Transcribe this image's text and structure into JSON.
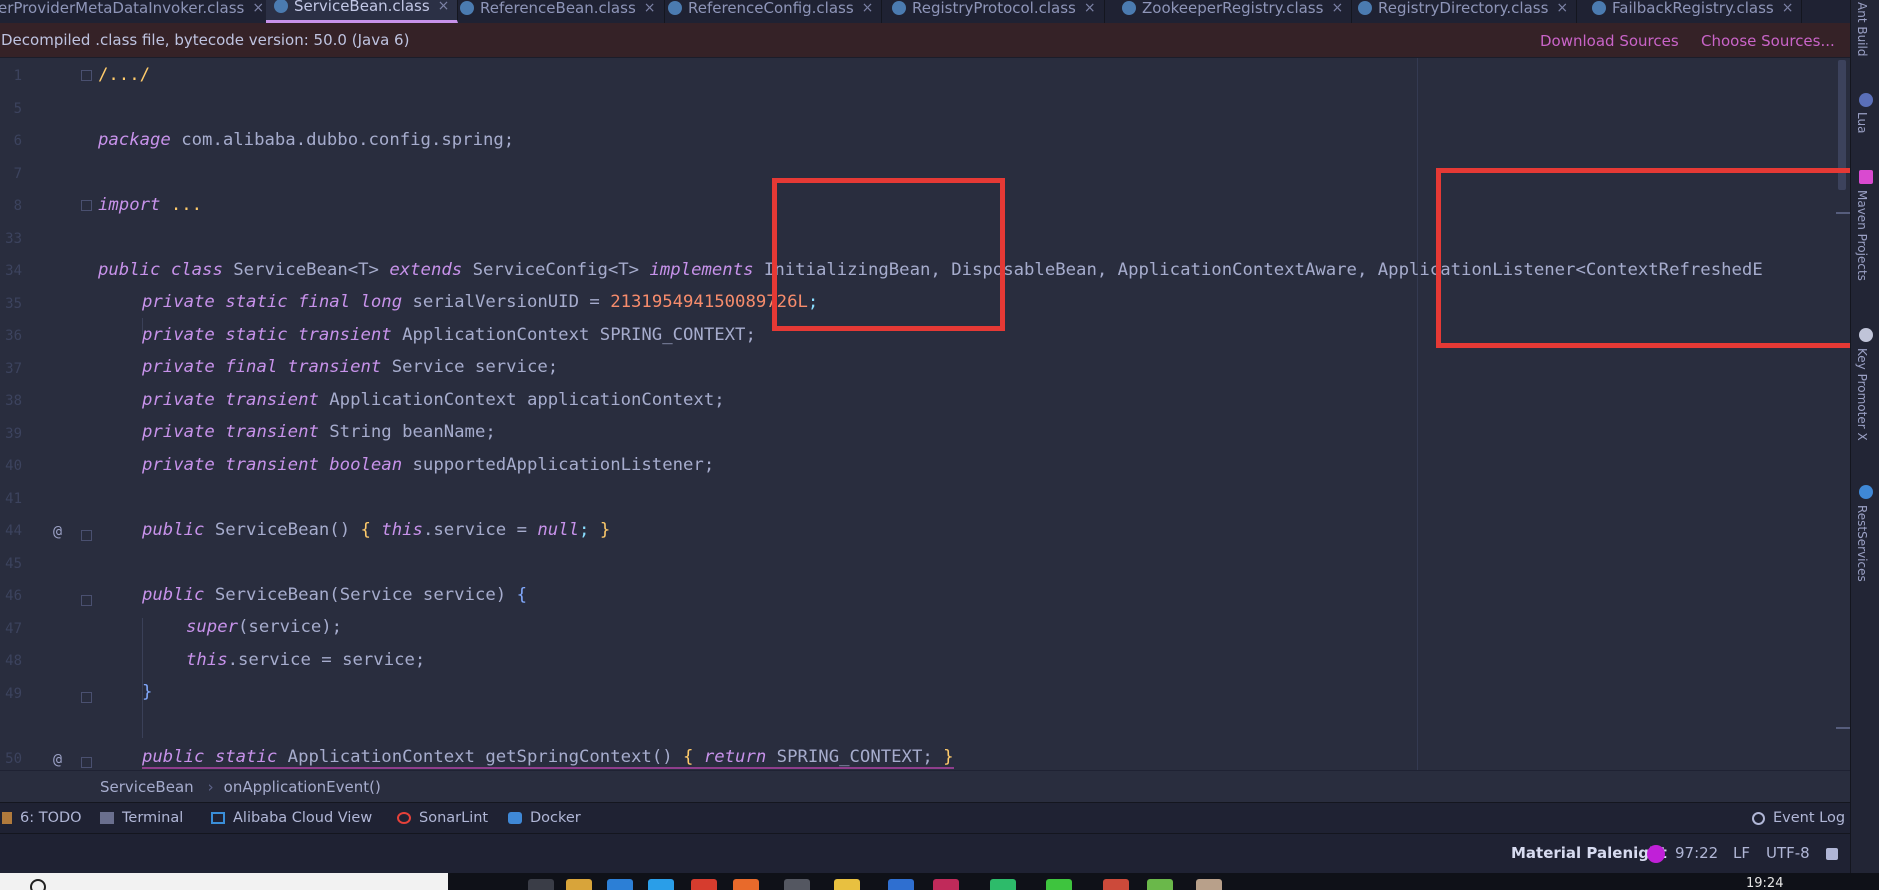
{
  "tabs": [
    {
      "label": "erProviderMetaDataInvoker.class",
      "active": false
    },
    {
      "label": "ServiceBean.class",
      "active": true
    },
    {
      "label": "ReferenceBean.class",
      "active": false
    },
    {
      "label": "ReferenceConfig.class",
      "active": false
    },
    {
      "label": "RegistryProtocol.class",
      "active": false
    },
    {
      "label": "ZookeeperRegistry.class",
      "active": false
    },
    {
      "label": "RegistryDirectory.class",
      "active": false
    },
    {
      "label": "FailbackRegistry.class",
      "active": false
    }
  ],
  "notice": {
    "message": "Decompiled .class file, bytecode version: 50.0 (Java 6)",
    "download_sources": "Download Sources",
    "choose_sources": "Choose Sources..."
  },
  "line_numbers": [
    "1",
    "5",
    "6",
    "7",
    "8",
    "33",
    "34",
    "35",
    "36",
    "37",
    "38",
    "39",
    "40",
    "41",
    "44",
    "45",
    "46",
    "47",
    "48",
    "49",
    "50"
  ],
  "code": {
    "l1": "/.../",
    "l6_kw": "package",
    "l6_rest": " com.alibaba.dubbo.config.spring;",
    "l8_kw": "import",
    "l8_rest": " ...",
    "l33_public": "public",
    "l33_class": "class",
    "l33_name": " ServiceBean<T> ",
    "l33_extends": "extends",
    "l33_sc": " ServiceConfig<T> ",
    "l33_impl": "implements",
    "l33_rest": " InitializingBean, DisposableBean, ApplicationContextAware, ApplicationListener<ContextRefreshedE",
    "l34_mods": "private static final long",
    "l34_name": " serialVersionUID = ",
    "l34_num": "213195494150089726L",
    "l34_end": ";",
    "l35_mods": "private static transient",
    "l35_rest": " ApplicationContext SPRING_CONTEXT;",
    "l36_mods": "private final transient",
    "l36_rest": " Service service;",
    "l37_mods": "private transient",
    "l37_rest": " ApplicationContext applicationContext;",
    "l38_mods": "private transient",
    "l38_rest": " String beanName;",
    "l39_mods": "private transient boolean",
    "l39_rest": " supportedApplicationListener;",
    "l41_public": "public",
    "l41_name": " ServiceBean() ",
    "l41_ob": "{",
    "l41_this": " this",
    "l41_mid": ".service = ",
    "l41_null": "null",
    "l41_semi": "; ",
    "l41_cb": "}",
    "l45_public": "public",
    "l45_rest": " ServiceBean(Service service) ",
    "l45_ob": "{",
    "l46_super": "super",
    "l46_rest": "(service);",
    "l47_this": "this",
    "l47_rest": ".service = service;",
    "l48_cb": "}",
    "l50_mods": "public static",
    "l50_mid": " ApplicationContext getSpringContext() ",
    "l50_ob": "{",
    "l50_return": " return",
    "l50_rest": " SPRING_CONTEXT; ",
    "l50_cb": "}",
    "gutter_at": "@"
  },
  "breadcrumb": {
    "class_name": "ServiceBean",
    "method": "onApplicationEvent()"
  },
  "tool_windows": [
    {
      "label": "6: TODO",
      "icon": "todo-icon"
    },
    {
      "label": "Terminal",
      "icon": "terminal-icon"
    },
    {
      "label": "Alibaba Cloud View",
      "icon": "cloud-icon"
    },
    {
      "label": "SonarLint",
      "icon": "sonarlint-icon"
    },
    {
      "label": "Docker",
      "icon": "docker-icon"
    }
  ],
  "event_log": "Event Log",
  "status": {
    "theme": "Material Palenight",
    "position": "97:22",
    "line_sep": "LF",
    "encoding": "UTF-8"
  },
  "right_tools": [
    "Ant Build",
    "Lua",
    "Maven Projects",
    "Key Promoter X",
    "RestServices"
  ],
  "clock": "19:24",
  "colors": {
    "background": "#292d3e",
    "keyword": "#c792ea",
    "number": "#f78c6c",
    "highlight_box": "#e53935",
    "brace": "#ffcb6b"
  }
}
